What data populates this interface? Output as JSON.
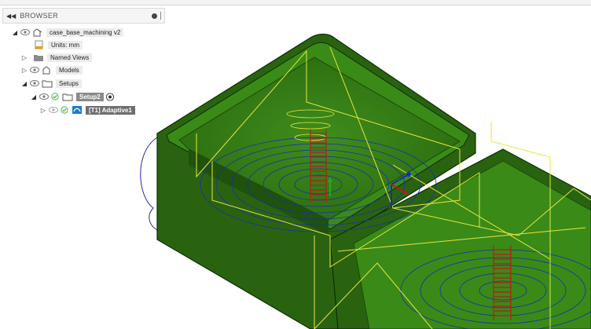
{
  "browser": {
    "title": "BROWSER",
    "items": [
      {
        "label": "case_base_machining v2"
      },
      {
        "label": "Units: mm"
      },
      {
        "label": "Named Views"
      },
      {
        "label": "Models"
      },
      {
        "label": "Setups"
      },
      {
        "label": "Setup2"
      },
      {
        "label": "[T1] Adaptive1"
      }
    ]
  },
  "colors": {
    "part_green": "#2d6a12",
    "toolpath_blue": "#1a2db0",
    "rapid_yellow": "#e6e63a",
    "drill_red": "#c01818",
    "panel_bg": "#f5f5f5"
  }
}
